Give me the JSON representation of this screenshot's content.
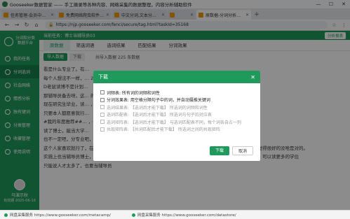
{
  "window": {
    "title": "Gooseeker数据管家 —— 手工摘录等各种内容、网络采集的数据整理，内容分析辅助软件",
    "minimize_icon": "minimize-icon",
    "maximize_icon": "maximize-icon",
    "close_icon": "close-icon"
  },
  "tabs": [
    {
      "label": "任务管理-会员中心-集搜客GooSeeker",
      "active": false
    },
    {
      "label": "免费网络爬虫软件,网页抓取工具,软件...",
      "active": false
    },
    {
      "label": "中文分词,文本分析,情感分析,关键词...",
      "active": false
    },
    {
      "label": "",
      "active": false
    },
    {
      "label": "原数据-分词分析和分析报表平台",
      "active": true
    }
  ],
  "address": {
    "url": "https://njp.gooseeker.com/fenci/secure/tag.html?taskId=35168"
  },
  "sidebar": {
    "logo_text": "分词和分类\n数据平台",
    "items": [
      {
        "label": "我的任务",
        "active": false
      },
      {
        "label": "分词选词",
        "active": true
      },
      {
        "label": "社会网络",
        "active": false
      },
      {
        "label": "情感分析",
        "active": false
      },
      {
        "label": "独有键词",
        "active": false
      },
      {
        "label": "分类管理",
        "active": false
      },
      {
        "label": "收藏管理",
        "active": false
      },
      {
        "label": "使用说明",
        "active": false
      }
    ],
    "user": {
      "name": "马演示秋",
      "date": "有效期 2025-06-19"
    }
  },
  "main": {
    "strip_left": "当前任务：博士当辅导员03",
    "strip_right": "分析报表",
    "subtabs": [
      {
        "label": "原数据",
        "active": true
      },
      {
        "label": "筛选词语",
        "active": false
      },
      {
        "label": "选词结果",
        "active": false
      },
      {
        "label": "匹配结果",
        "active": false
      },
      {
        "label": "分词效果",
        "active": false
      }
    ],
    "toolbar": {
      "import_label": "导入数据",
      "download_label": "下载",
      "hint": "共导入数据 225 条数据"
    },
    "paragraphs": [
      "看是什么专业了。有…",
      "每个人想法不一样，…                                                     2号鞍山·马鞍山万达广场",
      "D老鼠读博不是计划…",
      "那辅导员备去呀，这…                                              的现实是在艾有多少论文可写呢 大家都要养",
      "现在研究生毕业，读…                                              ，考编制这，认为我主要在体制内还可再做讲师。",
      "只要本人都愿意就行…",
      "#我的年度推荐##…                                             ，你把我…那里知道答案，上乘好读影视的微博视频",
      "读了博士，能当大学…",
      "也不一定吧，分专业吧，博士只能说专业知识很到位，并不就是什么高大上，主要高大上的岗位。",
      "这个人家喜欢就行了，在平凡的岗位也可以创造出不平凡的成绩，如果都在导员位上作出一不样的成绩，我觉得很好的没啥是对的。",
      "实施上也当辅导员博士，在不少学历读研辅导员职上，在中国的高校本科，我就是博士，他已经是辅导员了，可以读更多的学位",
      "只能说人才太多了，也要当辅导员"
    ]
  },
  "modal": {
    "title": "下载",
    "options": [
      {
        "label": "词频表: 所有词的词频和词性",
        "disabled": false
      },
      {
        "label": "分词效果表: 用空格分隔句子中的词，并自动摄推关键词",
        "disabled": false
      },
      {
        "label": "选词结果表: 【选词后才能下载】 所选词的词频和词性",
        "disabled": true
      },
      {
        "label": "选词匹配表: 【选词后才能下载】 所选词与句子的对应表",
        "disabled": true
      },
      {
        "label": "选词矩阵表: 【选词后才能下载】 与选词匹配表不同，每个词各自占一列",
        "disabled": true
      },
      {
        "label": "共现矩阵表: 【共词匹配后才能下载】 所选词之间的共现矩阵",
        "disabled": true
      }
    ],
    "confirm_label": "下载",
    "cancel_label": "取消"
  },
  "statusbar": {
    "items": [
      "网盘采集服务 https://www.gooseeker.com/metacamp/",
      "网盘采集服务 https://www.gooseeker.com/datastore/"
    ]
  },
  "colors": {
    "brand_green": "#1f9a5c",
    "overlay": "rgba(0,0,0,0.45)"
  }
}
